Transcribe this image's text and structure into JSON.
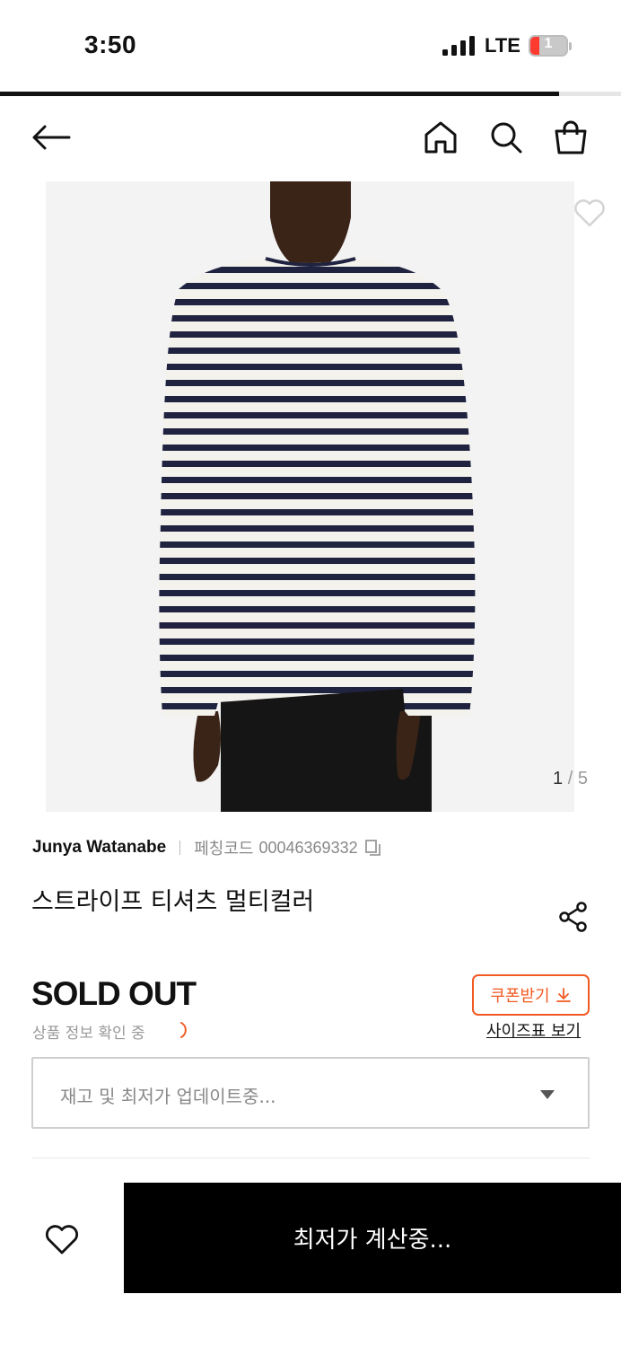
{
  "status_bar": {
    "time": "3:50",
    "network": "LTE",
    "battery": "1",
    "battery_color": "#ff3b30"
  },
  "page_progress": 0.9,
  "nav": {
    "back_icon": "arrow-left-icon",
    "home_icon": "home-icon",
    "search_icon": "search-icon",
    "cart_icon": "shopping-bag-icon"
  },
  "gallery": {
    "current": "1",
    "separator": "/",
    "total": "5",
    "wishlist_icon": "heart-outline-icon"
  },
  "product": {
    "brand": "Junya Watanabe",
    "code_label": "페칭코드",
    "code_value": "00046369332",
    "name": "스트라이프 티셔츠 멀티컬러",
    "price_status": "SOLD OUT",
    "info_status": "상품 정보 확인 중"
  },
  "coupon": {
    "label": "쿠폰받기",
    "color": "#f15a22",
    "icon": "download-icon"
  },
  "size_chart_link": "사이즈표 보기",
  "option_select": {
    "placeholder": "재고 및 최저가 업데이트중..."
  },
  "bottom_bar": {
    "wishlist_icon": "heart-outline-icon",
    "buy_label": "최저가 계산중..."
  }
}
